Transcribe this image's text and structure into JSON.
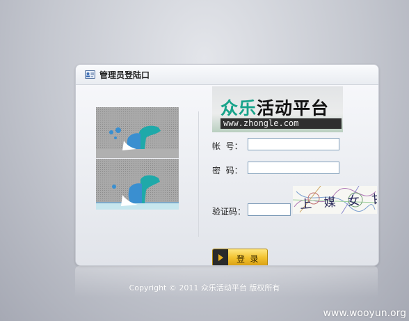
{
  "panel": {
    "title": "管理员登陆口"
  },
  "banner": {
    "title_part1": "众乐",
    "title_part2": "活动平台",
    "url": "www.zhongle.com"
  },
  "form": {
    "account_label": "帐  号：",
    "account_value": "",
    "password_label": "密  码：",
    "password_value": "",
    "captcha_label": "验证码：",
    "captcha_value": "",
    "captcha_text": "上 媒 女 甘",
    "login_label": "登 录"
  },
  "footer": {
    "copyright": "Copyright © 2011 众乐活动平台 版权所有"
  },
  "watermark": "www.wooyun.org",
  "colors": {
    "accent_teal": "#17a38a",
    "button_gold": "#f2c230",
    "input_border": "#7f9db9"
  }
}
